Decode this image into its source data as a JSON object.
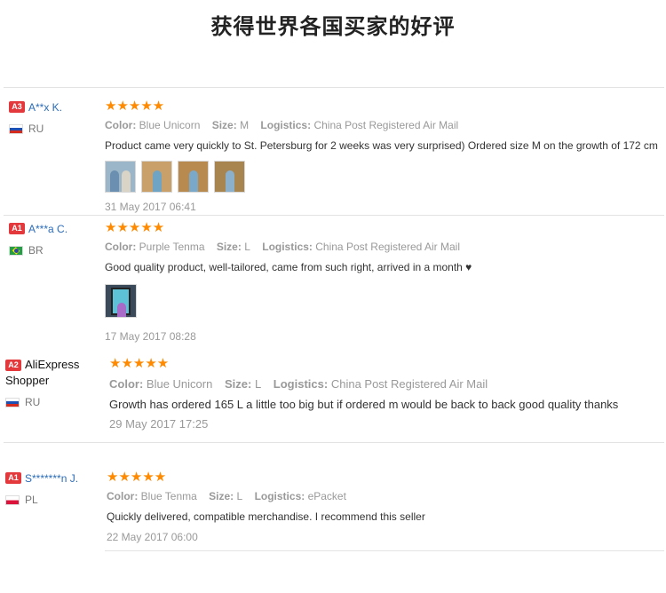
{
  "page_title": "获得世界各国买家的好评",
  "star_glyphs": "★★★★★",
  "reviews": [
    {
      "level": "A3",
      "user": "A**x K.",
      "country": "RU",
      "color_label": "Color:",
      "color": "Blue Unicorn",
      "size_label": "Size:",
      "size": "M",
      "logistics_label": "Logistics:",
      "logistics": "China Post Registered Air Mail",
      "text": "Product came very quickly to St. Petersburg for 2 weeks was very surprised) Ordered size M on the growth of 172 cm",
      "date": "31 May 2017 06:41",
      "rating": 5
    },
    {
      "level": "A1",
      "user": "A***a C.",
      "country": "BR",
      "color_label": "Color:",
      "color": "Purple Tenma",
      "size_label": "Size:",
      "size": "L",
      "logistics_label": "Logistics:",
      "logistics": "China Post Registered Air Mail",
      "text": "Good quality product, well-tailored, came from such right, arrived in a month ♥",
      "date": "17 May 2017 08:28",
      "rating": 5
    },
    {
      "level": "A2",
      "user": "AliExpress Shopper",
      "country": "RU",
      "color_label": "Color:",
      "color": "Blue Unicorn",
      "size_label": "Size:",
      "size": "L",
      "logistics_label": "Logistics:",
      "logistics": "China Post Registered Air Mail",
      "text": "Growth has ordered 165 L a little too big but if ordered m would be back to back good quality thanks",
      "date": "29 May 2017 17:25",
      "rating": 5
    },
    {
      "level": "A1",
      "user": "S*******n J.",
      "country": "PL",
      "color_label": "Color:",
      "color": "Blue Tenma",
      "size_label": "Size:",
      "size": "L",
      "logistics_label": "Logistics:",
      "logistics": "ePacket",
      "text": "Quickly delivered, compatible merchandise. I recommend this seller",
      "date": "22 May 2017 06:00",
      "rating": 5
    }
  ]
}
